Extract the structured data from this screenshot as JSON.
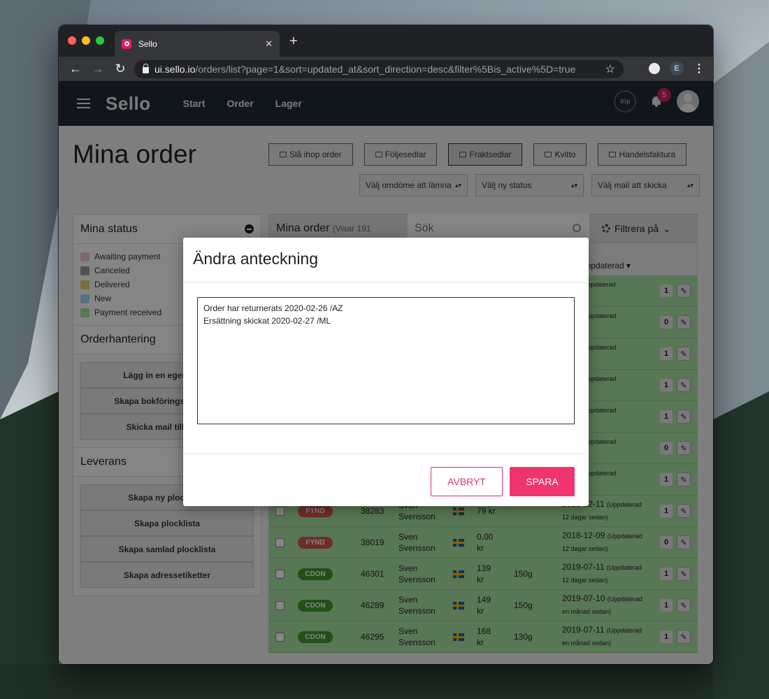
{
  "browser": {
    "tab_title": "Sello",
    "url_host": "ui.sello.io",
    "url_path": "/orders/list?page=1&sort=updated_at&sort_direction=desc&filter%5Bis_active%5D=true",
    "profile_initial": "E"
  },
  "app": {
    "brand": "Sello",
    "nav": [
      "Start",
      "Order",
      "Lager"
    ],
    "quota": "40p",
    "notification_count": "5"
  },
  "page": {
    "title": "Mina order",
    "actions": [
      "Slå ihop order",
      "Följesedlar",
      "Fraktsedlar",
      "Kvitto",
      "Handelsfaktura"
    ],
    "selects": [
      "Välj omdöme att lämna",
      "Välj ny status",
      "Välj mail att skicka"
    ]
  },
  "sidebar": {
    "status_title": "Mina status",
    "statuses": [
      {
        "label": "Awaiting payment",
        "color": "#f2c9d8"
      },
      {
        "label": "Canceled",
        "color": "#9b9b9b"
      },
      {
        "label": "Delivered",
        "color": "#e8d36b"
      },
      {
        "label": "New",
        "color": "#a9d6f2"
      },
      {
        "label": "Payment received",
        "color": "#a9e4a3"
      }
    ],
    "orderhantering_title": "Orderhantering",
    "orderhantering_buttons": [
      "Lägg in en egen order",
      "Skapa bokföringsunderlag",
      "Skicka mail till order"
    ],
    "leverans_title": "Leverans",
    "leverans_buttons": [
      "Skapa ny plocklista",
      "Skapa plocklista",
      "Skapa samlad plocklista",
      "Skapa adressetiketter"
    ]
  },
  "orders": {
    "title": "Mina order",
    "showing": "(Visar 191",
    "search_placeholder": "Sök",
    "filter_label": "Filtrera på",
    "sort_label": "Uppdaterad ▾",
    "rows": [
      {
        "channel": "FYND",
        "channel_color": "#d9534f",
        "number": "38283",
        "name1": "Sven",
        "name2": "Svensson",
        "price1": "79 kr",
        "price2": "",
        "weight": "",
        "date": "2018-12-11",
        "ago1": "(Uppdaterad",
        "ago2": "12 dagar sedan)",
        "count": "1"
      },
      {
        "channel": "FYND",
        "channel_color": "#d9534f",
        "number": "38019",
        "name1": "Sven",
        "name2": "Svensson",
        "price1": "0,00",
        "price2": "kr",
        "weight": "",
        "date": "2018-12-09",
        "ago1": "(Uppdaterad",
        "ago2": "12 dagar sedan)",
        "count": "0"
      },
      {
        "channel": "CDON",
        "channel_color": "#3e9a2b",
        "number": "46301",
        "name1": "Sven",
        "name2": "Svensson",
        "price1": "139",
        "price2": "kr",
        "weight": "150g",
        "date": "2019-07-11",
        "ago1": "(Uppdaterad",
        "ago2": "12 dagar sedan)",
        "count": "1"
      },
      {
        "channel": "CDON",
        "channel_color": "#3e9a2b",
        "number": "46289",
        "name1": "Sven",
        "name2": "Svensson",
        "price1": "149",
        "price2": "kr",
        "weight": "150g",
        "date": "2019-07-10",
        "ago1": "(Uppdaterad",
        "ago2": "en månad sedan)",
        "count": "1"
      },
      {
        "channel": "CDON",
        "channel_color": "#3e9a2b",
        "number": "46295",
        "name1": "Sven",
        "name2": "Svensson",
        "price1": "168",
        "price2": "kr",
        "weight": "130g",
        "date": "2019-07-11",
        "ago1": "(Uppdaterad",
        "ago2": "en månad sedan)",
        "count": "1"
      }
    ],
    "hidden_rows": [
      {
        "date": "7-11",
        "ago1": "(Uppdaterad",
        "ago2": "sedan)",
        "count": "1"
      },
      {
        "date": "2-08",
        "ago1": "(Uppdaterad",
        "ago2": "sedan)",
        "count": "0"
      },
      {
        "date": "7-10",
        "ago1": "(Uppdaterad",
        "ago2": "sedan)",
        "count": "1"
      },
      {
        "date": "7-10",
        "ago1": "(Uppdaterad",
        "ago2": "sedan)",
        "count": "1"
      },
      {
        "date": "7-10",
        "ago1": "(Uppdaterad",
        "ago2": "sedan)",
        "count": "1"
      },
      {
        "date": "2-09",
        "ago1": "(Uppdaterad",
        "ago2": "sedan)",
        "count": "0"
      },
      {
        "date": "7-10",
        "ago1": "(Uppdaterad",
        "ago2": "sedan)",
        "count": "1"
      }
    ]
  },
  "modal": {
    "title": "Ändra anteckning",
    "note_text": "Order har returnerats 2020-02-26 /AZ\nErsättning skickat 2020-02-27 /ML",
    "cancel_label": "AVBRYT",
    "save_label": "SPARA"
  }
}
